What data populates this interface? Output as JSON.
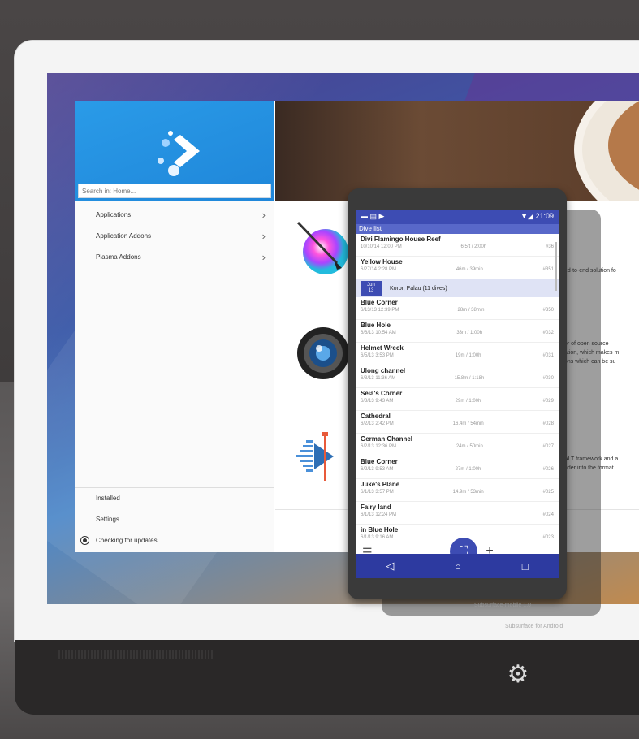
{
  "sidebar": {
    "search_placeholder": "Search in: Home...",
    "items": [
      {
        "label": "Applications",
        "chevron": "chevron-right-icon"
      },
      {
        "label": "Application Addons",
        "chevron": "chevron-right-icon"
      },
      {
        "label": "Plasma Addons",
        "chevron": "chevron-right-icon"
      }
    ],
    "footer": [
      {
        "label": "Installed"
      },
      {
        "label": "Settings"
      },
      {
        "label": "Checking for updates..."
      }
    ]
  },
  "content": {
    "rows": [
      {
        "icon": "krita-brush-icon",
        "text": [
          "ed-to-end solution fo"
        ]
      },
      {
        "icon": "camera-lens-icon",
        "text": [
          "er of open source",
          "ation, which makes m",
          "ons which can be su"
        ]
      },
      {
        "icon": "audio-waveform-icon",
        "text": [
          "ALT framework and a",
          "nder into the format"
        ]
      }
    ]
  },
  "phone": {
    "status_right": "▼◢ 21:09",
    "toolbar_title": "Dive list",
    "dives": [
      {
        "name": "Divi Flamingo House Reef",
        "date": "10/10/14 12:00 PM",
        "depth": "6.5ft / 2:00h",
        "num": "#36"
      },
      {
        "name": "Yellow House",
        "date": "6/27/14 2:28 PM",
        "depth": "46m / 39min",
        "num": "#351"
      },
      {
        "name": "Blue Corner",
        "date": "6/13/13 12:39 PM",
        "depth": "28m / 38min",
        "num": "#350"
      },
      {
        "name": "Blue Hole",
        "date": "6/6/13 10:54 AM",
        "depth": "33m / 1:00h",
        "num": "#032"
      },
      {
        "name": "Helmet Wreck",
        "date": "6/5/13 3:53 PM",
        "depth": "19m / 1:00h",
        "num": "#031"
      },
      {
        "name": "Ulong channel",
        "date": "6/3/13 11:36 AM",
        "depth": "15.8m / 1:18h",
        "num": "#030"
      },
      {
        "name": "Seia's Corner",
        "date": "6/3/13 9:43 AM",
        "depth": "29m / 1:00h",
        "num": "#029"
      },
      {
        "name": "Cathedral",
        "date": "6/2/13 2:42 PM",
        "depth": "16.4m / 54min",
        "num": "#028"
      },
      {
        "name": "German Channel",
        "date": "6/2/13 12:36 PM",
        "depth": "24m / 50min",
        "num": "#027"
      },
      {
        "name": "Blue Corner",
        "date": "6/2/13 9:53 AM",
        "depth": "27m / 1:00h",
        "num": "#026"
      },
      {
        "name": "Juke's Plane",
        "date": "6/1/13 3:57 PM",
        "depth": "14.9m / 53min",
        "num": "#025"
      },
      {
        "name": "Fairy land",
        "date": "6/1/13 12:24 PM",
        "depth": "",
        "num": "#024"
      },
      {
        "name": "in Blue Hole",
        "date": "6/1/13 9:16 AM",
        "depth": "",
        "num": "#023"
      }
    ],
    "trip": {
      "badge_month": "Jun",
      "badge_day": "13",
      "title": "Koror, Palau (11 dives)"
    },
    "fab_icon": "dive-mask-icon",
    "nav": [
      "◁",
      "○",
      "□"
    ]
  },
  "captions": {
    "line1": "Subsurface-mobile 1.0",
    "line2": "Subsurface for Android"
  }
}
